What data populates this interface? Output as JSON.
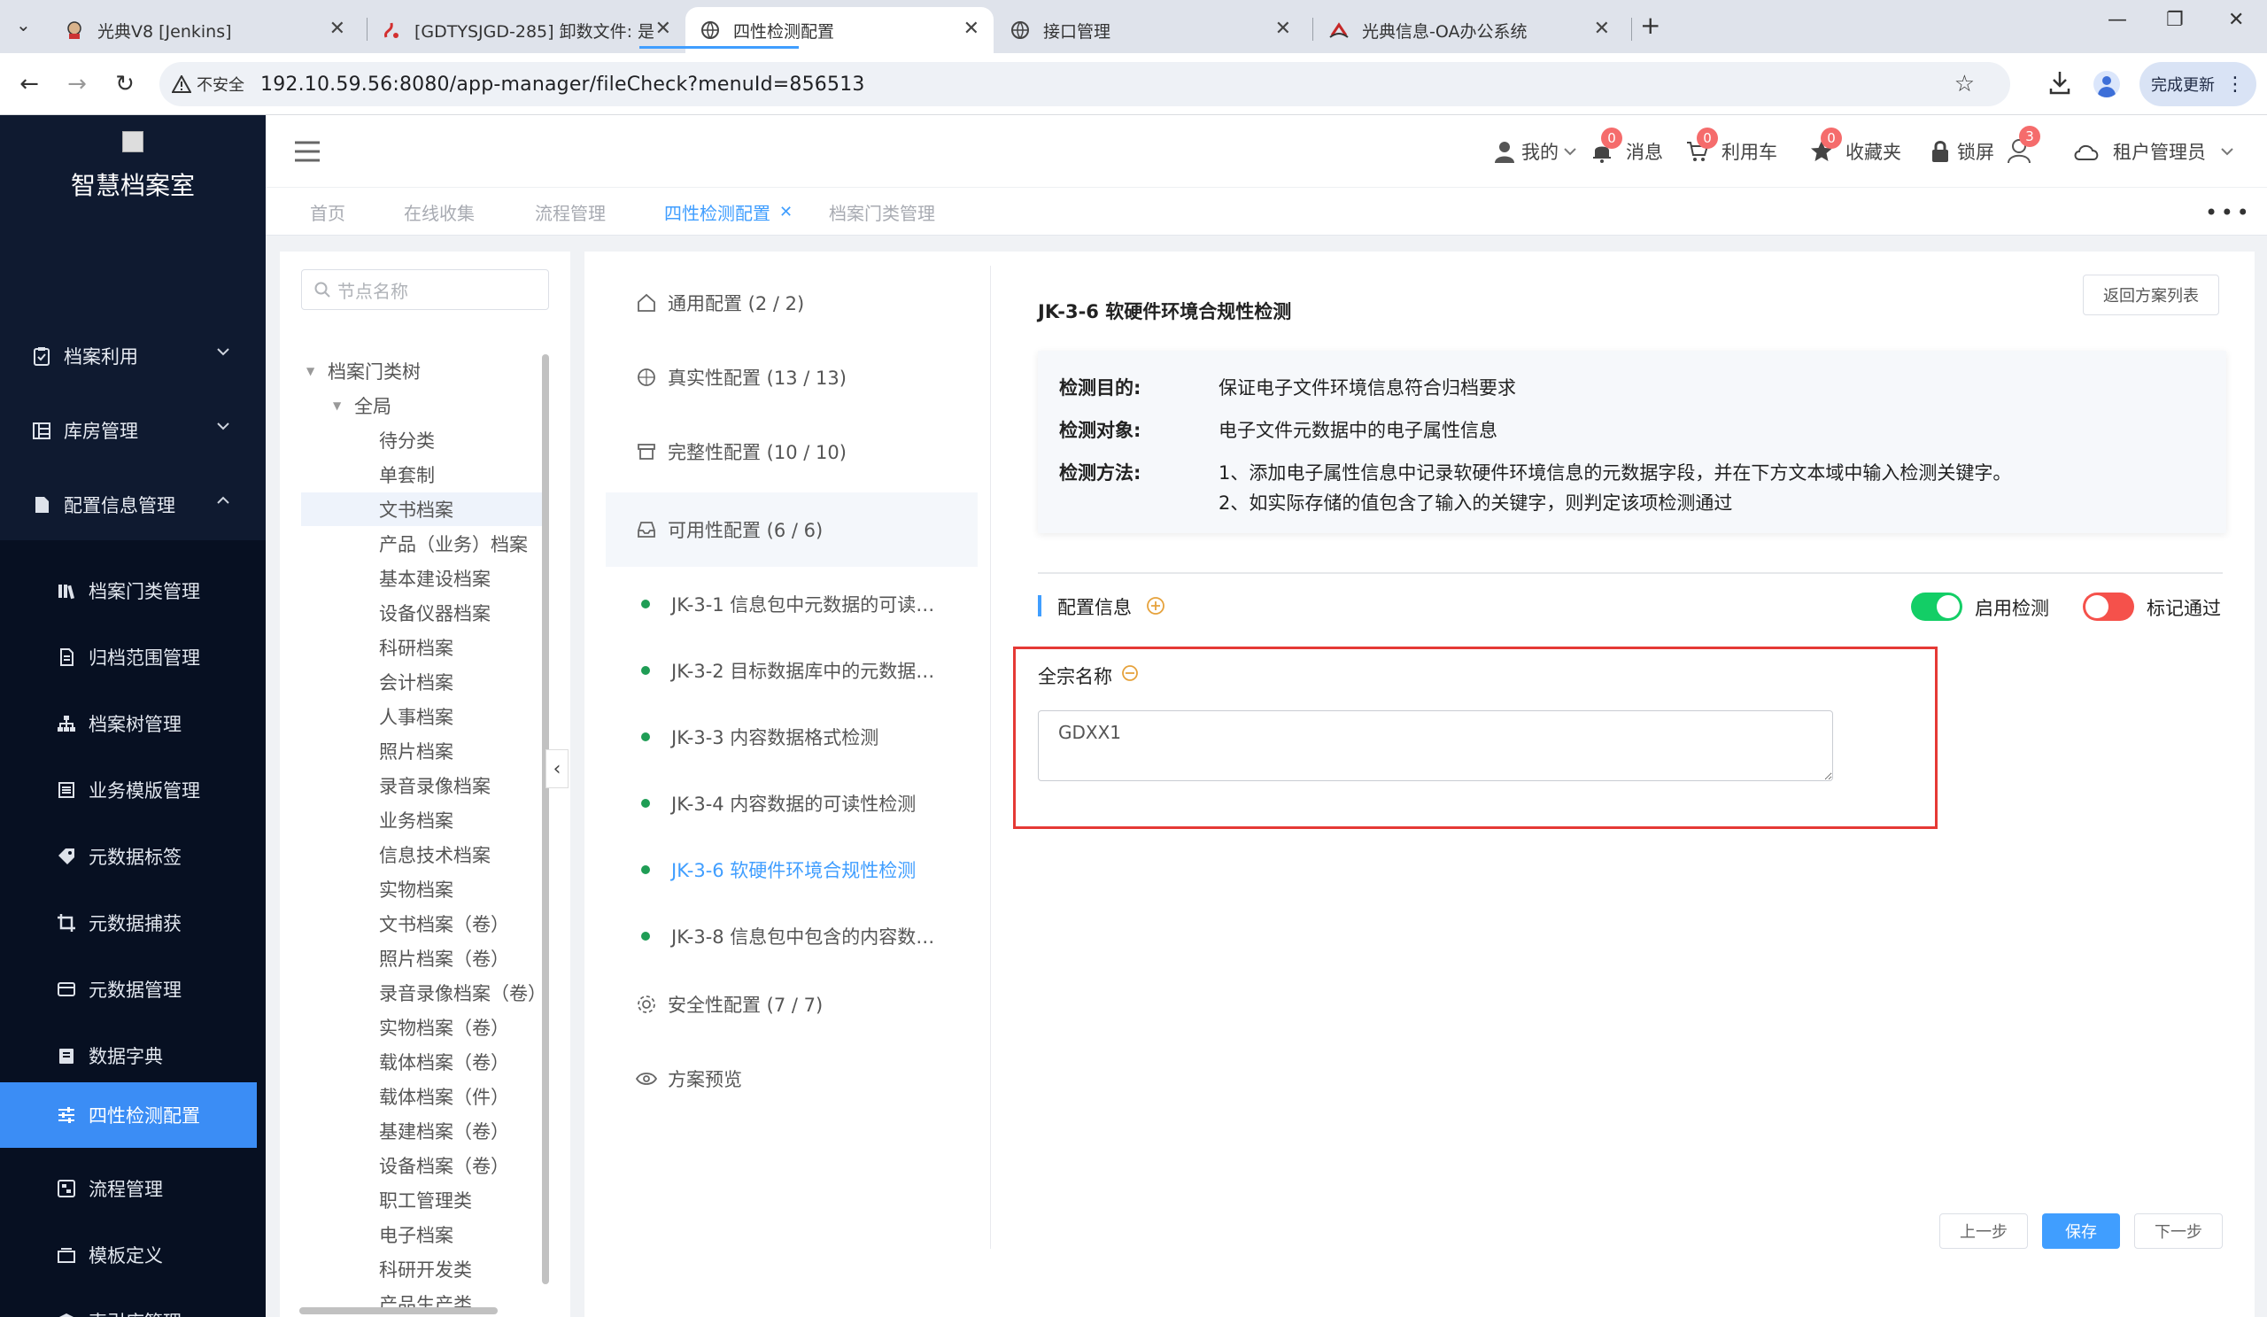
{
  "browser": {
    "tabs": [
      {
        "label": "光典V8 [Jenkins]",
        "icon": "jenkins-icon"
      },
      {
        "label": "[GDTYSJGD-285] 卸数文件: 是",
        "icon": "jira-icon"
      },
      {
        "label": "四性检测配置",
        "icon": "globe-icon"
      },
      {
        "label": "接口管理",
        "icon": "globe-icon"
      },
      {
        "label": "光典信息-OA办公系统",
        "icon": "oa-icon"
      }
    ],
    "insecure_label": "不安全",
    "url": "192.10.59.56:8080/app-manager/fileCheck?menuId=856513",
    "update_button": "完成更新"
  },
  "sidebar": {
    "title": "智慧档案室",
    "top_items": [
      {
        "label": "档案利用",
        "icon": "clipboard-icon"
      },
      {
        "label": "库房管理",
        "icon": "warehouse-icon"
      },
      {
        "label": "配置信息管理",
        "icon": "file-icon"
      }
    ],
    "sub_items": [
      {
        "label": "档案门类管理",
        "icon": "books-icon"
      },
      {
        "label": "归档范围管理",
        "icon": "doc-icon"
      },
      {
        "label": "档案树管理",
        "icon": "tree-icon"
      },
      {
        "label": "业务模版管理",
        "icon": "template-icon"
      },
      {
        "label": "元数据标签",
        "icon": "tag-icon"
      },
      {
        "label": "元数据捕获",
        "icon": "crop-icon"
      },
      {
        "label": "元数据管理",
        "icon": "card-icon"
      },
      {
        "label": "数据字典",
        "icon": "book-icon"
      },
      {
        "label": "四性检测配置",
        "icon": "sliders-icon"
      },
      {
        "label": "流程管理",
        "icon": "flow-icon"
      },
      {
        "label": "模板定义",
        "icon": "layers-icon"
      },
      {
        "label": "索引库管理",
        "icon": "stack-icon"
      }
    ]
  },
  "header": {
    "mine": "我的",
    "messages": {
      "label": "消息",
      "count": "0"
    },
    "cart": {
      "label": "利用车",
      "count": "0"
    },
    "favorites": {
      "label": "收藏夹",
      "count": "0"
    },
    "lock": "锁屏",
    "user_count": "3",
    "admin": "租户管理员"
  },
  "page_tabs": [
    "首页",
    "在线收集",
    "流程管理",
    "四性检测配置",
    "档案门类管理"
  ],
  "tree": {
    "search_placeholder": "节点名称",
    "root": "档案门类树",
    "group": "全局",
    "nodes": [
      "待分类",
      "单套制",
      "文书档案",
      "产品（业务）档案",
      "基本建设档案",
      "设备仪器档案",
      "科研档案",
      "会计档案",
      "人事档案",
      "照片档案",
      "录音录像档案",
      "业务档案",
      "信息技术档案",
      "实物档案",
      "文书档案（卷）",
      "照片档案（卷）",
      "录音录像档案（卷）",
      "实物档案（卷）",
      "载体档案（卷）",
      "载体档案（件）",
      "基建档案（卷）",
      "设备档案（卷）",
      "职工管理类",
      "电子档案",
      "科研开发类",
      "产品生产类"
    ]
  },
  "check_menu": {
    "groups_top": [
      {
        "label": "通用配置 (2 / 2)",
        "icon": "home-icon"
      },
      {
        "label": "真实性配置 (13 / 13)",
        "icon": "compass-icon"
      },
      {
        "label": "完整性配置 (10 / 10)",
        "icon": "box-icon"
      },
      {
        "label": "可用性配置 (6 / 6)",
        "icon": "inbox-icon"
      }
    ],
    "items": [
      "JK-3-1 信息包中元数据的可读…",
      "JK-3-2 目标数据库中的元数据…",
      "JK-3-3 内容数据格式检测",
      "JK-3-4 内容数据的可读性检测",
      "JK-3-6 软硬件环境合规性检测",
      "JK-3-8 信息包中包含的内容数…"
    ],
    "groups_bottom": [
      {
        "label": "安全性配置 (7 / 7)",
        "icon": "gear-icon"
      },
      {
        "label": "方案预览",
        "icon": "eye-icon"
      }
    ]
  },
  "detail": {
    "title": "JK-3-6 软硬件环境合规性检测",
    "back_button": "返回方案列表",
    "purpose_label": "检测目的:",
    "purpose": "保证电子文件环境信息符合归档要求",
    "object_label": "检测对象:",
    "object": "电子文件元数据中的电子属性信息",
    "method_label": "检测方法:",
    "method_1": "1、添加电子属性信息中记录软硬件环境信息的元数据字段，并在下方文本域中输入检测关键字。",
    "method_2": "2、如实际存储的值包含了输入的关键字，则判定该项检测通过",
    "config_title": "配置信息",
    "enable_label": "启用检测",
    "enable_on": true,
    "mark_label": "标记通过",
    "mark_on": false,
    "field_label": "全宗名称",
    "field_value": "GDXX1",
    "prev_button": "上一步",
    "save_button": "保存",
    "next_button": "下一步"
  },
  "colors": {
    "sidebar_bg": "#0f1a30",
    "accent": "#409eff",
    "switch_on": "#13ce66",
    "switch_off": "#f5514b",
    "badge": "#f56c6c",
    "highlight": "#e53935"
  }
}
